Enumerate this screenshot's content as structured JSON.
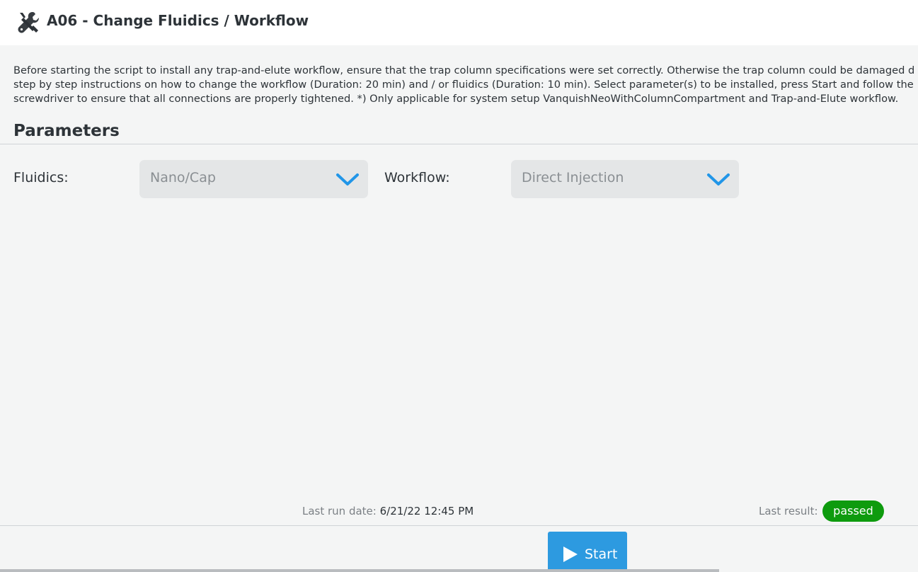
{
  "header": {
    "icon": "tools-icon",
    "title": "A06 - Change Fluidics / Workflow"
  },
  "description": {
    "lines": [
      "Before starting the script to install any trap-and-elute workflow, ensure that the trap column specifications were set correctly. Otherwise the trap column could be damaged d",
      "step by step instructions on how to change the workflow (Duration: 20 min) and / or fluidics (Duration: 10 min). Select parameter(s) to be installed, press Start and follow the",
      "screwdriver to ensure that all connections are properly tightened. *) Only applicable for system setup VanquishNeoWithColumnCompartment and Trap-and-Elute workflow."
    ]
  },
  "parameters": {
    "title": "Parameters",
    "fluidics": {
      "label": "Fluidics:",
      "value": "Nano/Cap"
    },
    "workflow": {
      "label": "Workflow:",
      "value": "Direct Injection"
    }
  },
  "status": {
    "last_run_label": "Last run date:",
    "last_run_value": "6/21/22 12:45 PM",
    "last_result_label": "Last result:",
    "last_result_value": "passed"
  },
  "actions": {
    "start_label": "Start"
  },
  "colors": {
    "accent": "#2d9ae0",
    "chevron": "#2196e8",
    "passed": "#0e9b0e"
  }
}
